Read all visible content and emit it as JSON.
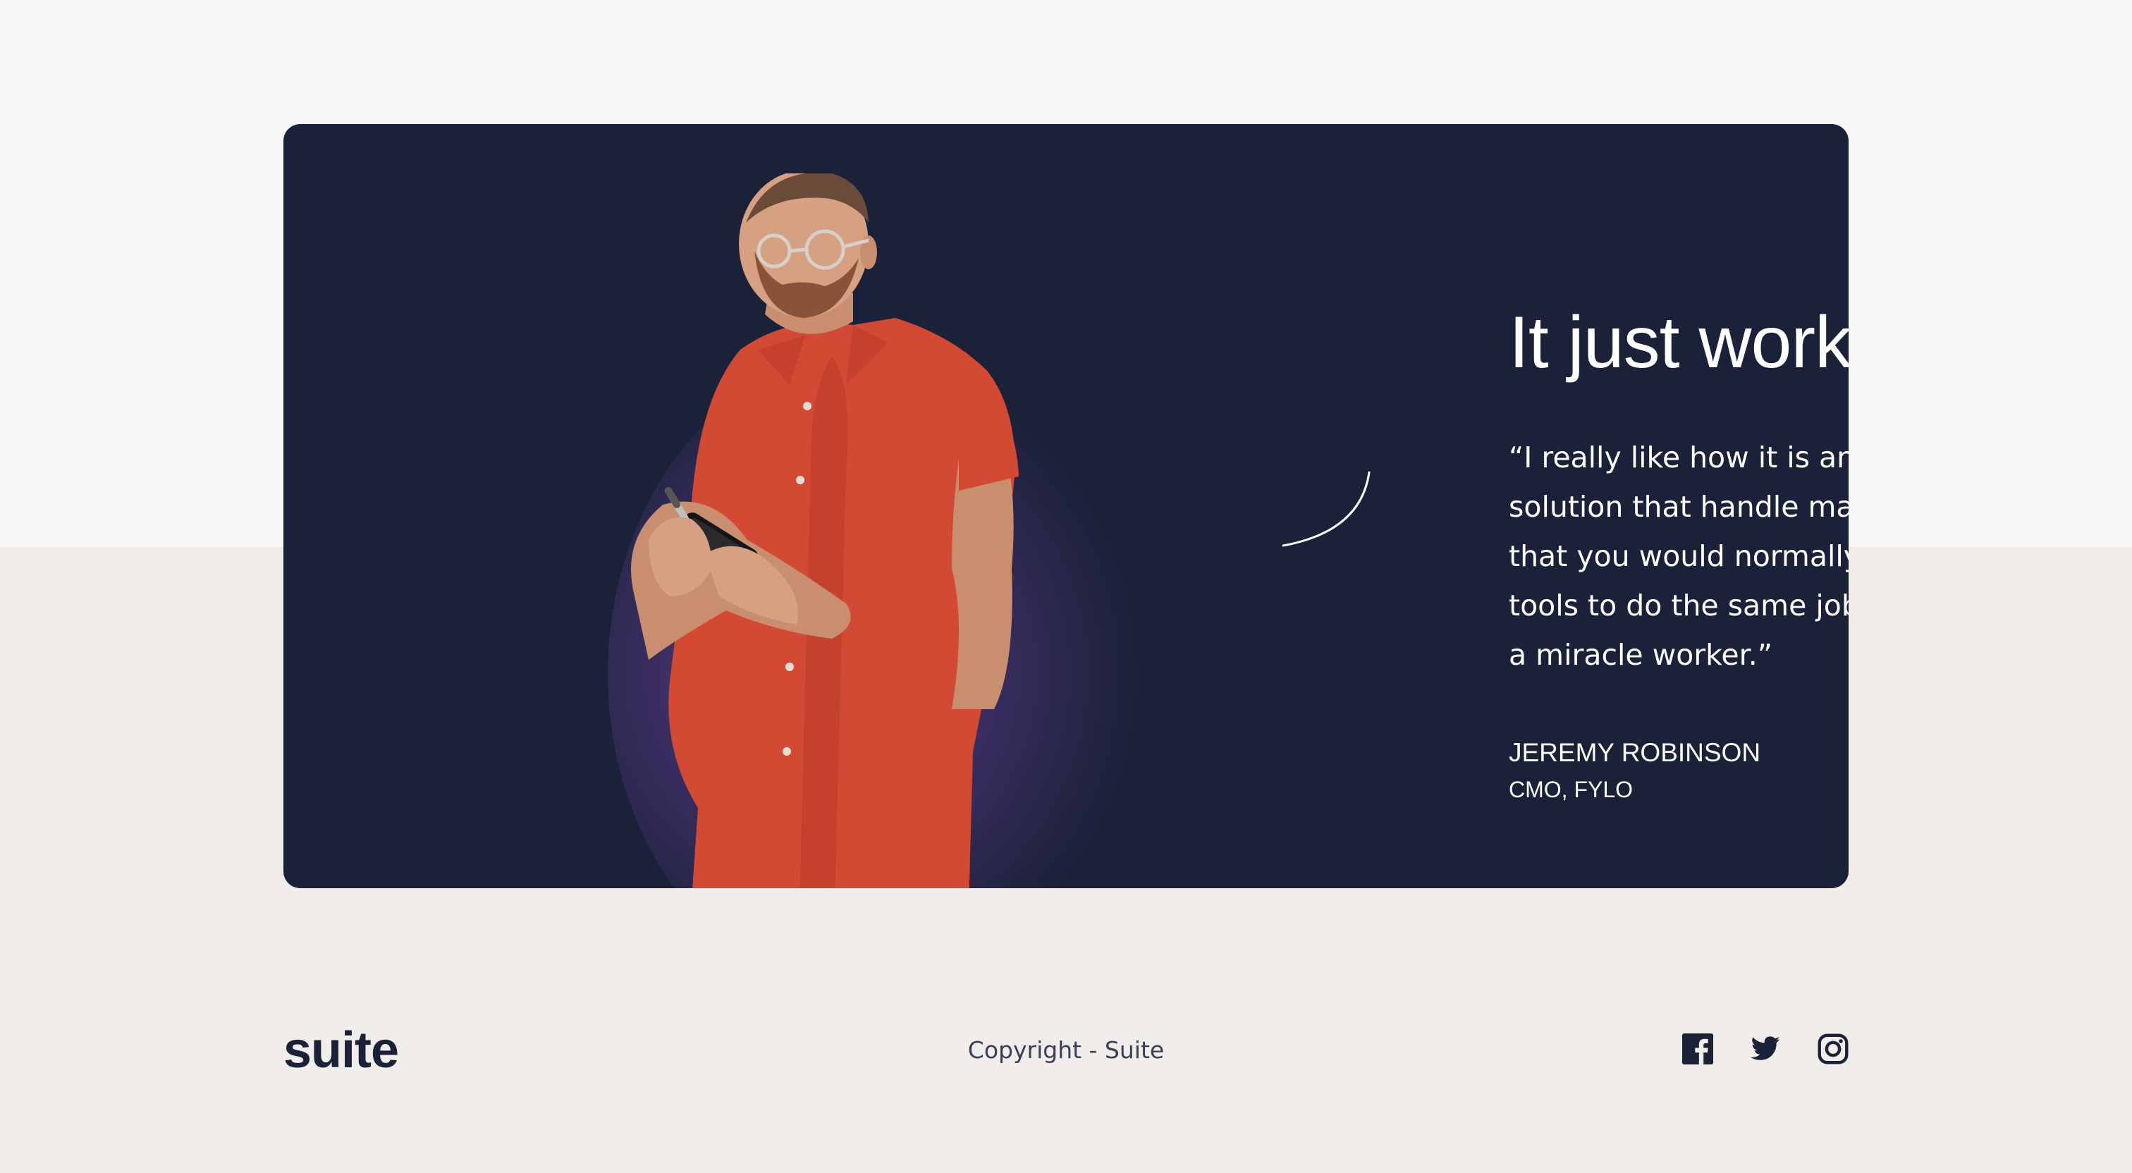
{
  "testimonial": {
    "headline": "It just works.",
    "quote": "“I really like how it is an all-in-one solution that handle many of the tasks that you would normally need separate tools to do the same job. This thing is a miracle worker.”",
    "author_name": "JEREMY ROBINSON",
    "author_role": "CMO, FYLO"
  },
  "footer": {
    "logo": "suite",
    "copyright": "Copyright - Suite",
    "social_links": [
      {
        "icon": "facebook-icon"
      },
      {
        "icon": "twitter-icon"
      },
      {
        "icon": "instagram-icon"
      }
    ]
  },
  "colors": {
    "card_background": "#1b2139",
    "page_top": "#f8f7f6",
    "page_bottom": "#f1edea",
    "accent_shirt": "#d24a33",
    "glow": "#6e4696",
    "text_dark": "#1b2139"
  }
}
